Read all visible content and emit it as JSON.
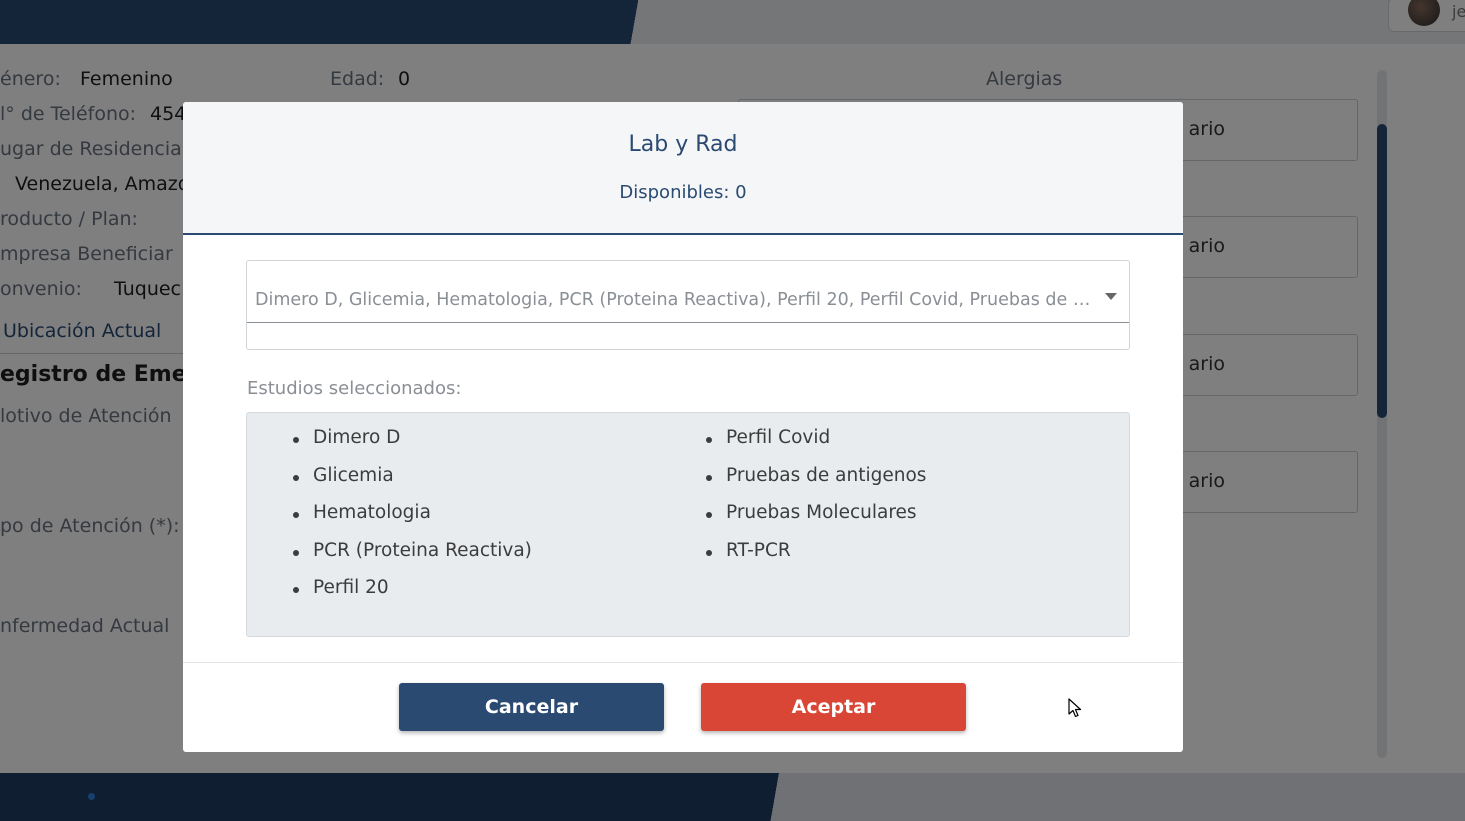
{
  "background": {
    "fields": [
      {
        "label": "énero:",
        "value": "Femenino"
      },
      {
        "label": "Edad:",
        "value": "0"
      },
      {
        "label": "l° de Teléfono:",
        "value": "454"
      },
      {
        "label": "ugar de Residencia",
        "value": "Venezuela, Amazo"
      },
      {
        "label": "roducto / Plan:",
        "value": ""
      },
      {
        "label": "mpresa Beneficiar",
        "value": ""
      },
      {
        "label": "onvenio:",
        "value": "Tuquec"
      }
    ],
    "location_link": "Ubicación Actual",
    "section_heading": "egistro de Emer",
    "motivo_label": "lotivo de Atención",
    "tipo_label": "po de Atención (*):",
    "enfermedad_label": "nfermedad Actual",
    "alergias_label": "Alergias",
    "right_inputs": [
      "ario",
      "ario",
      "ario",
      "ario"
    ],
    "user_initial": "je"
  },
  "modal": {
    "title": "Lab y Rad",
    "available": "Disponibles: 0",
    "select_value": "Dimero D, Glicemia, Hematologia, PCR (Proteina Reactiva), Perfil 20, Perfil Covid, Pruebas de antigenos, Pruebas Moleculares, RT-PCR",
    "selected_label": "Estudios seleccionados:",
    "studies_col1": [
      "Dimero D",
      "Glicemia",
      "Hematologia",
      "PCR (Proteina Reactiva)",
      "Perfil 20"
    ],
    "studies_col2": [
      "Perfil Covid",
      "Pruebas de antigenos",
      "Pruebas Moleculares",
      "RT-PCR"
    ],
    "cancel_label": "Cancelar",
    "accept_label": "Aceptar"
  },
  "colors": {
    "primary": "#2a4a72",
    "accept": "#d94635",
    "list_bg": "#e8ecef"
  }
}
